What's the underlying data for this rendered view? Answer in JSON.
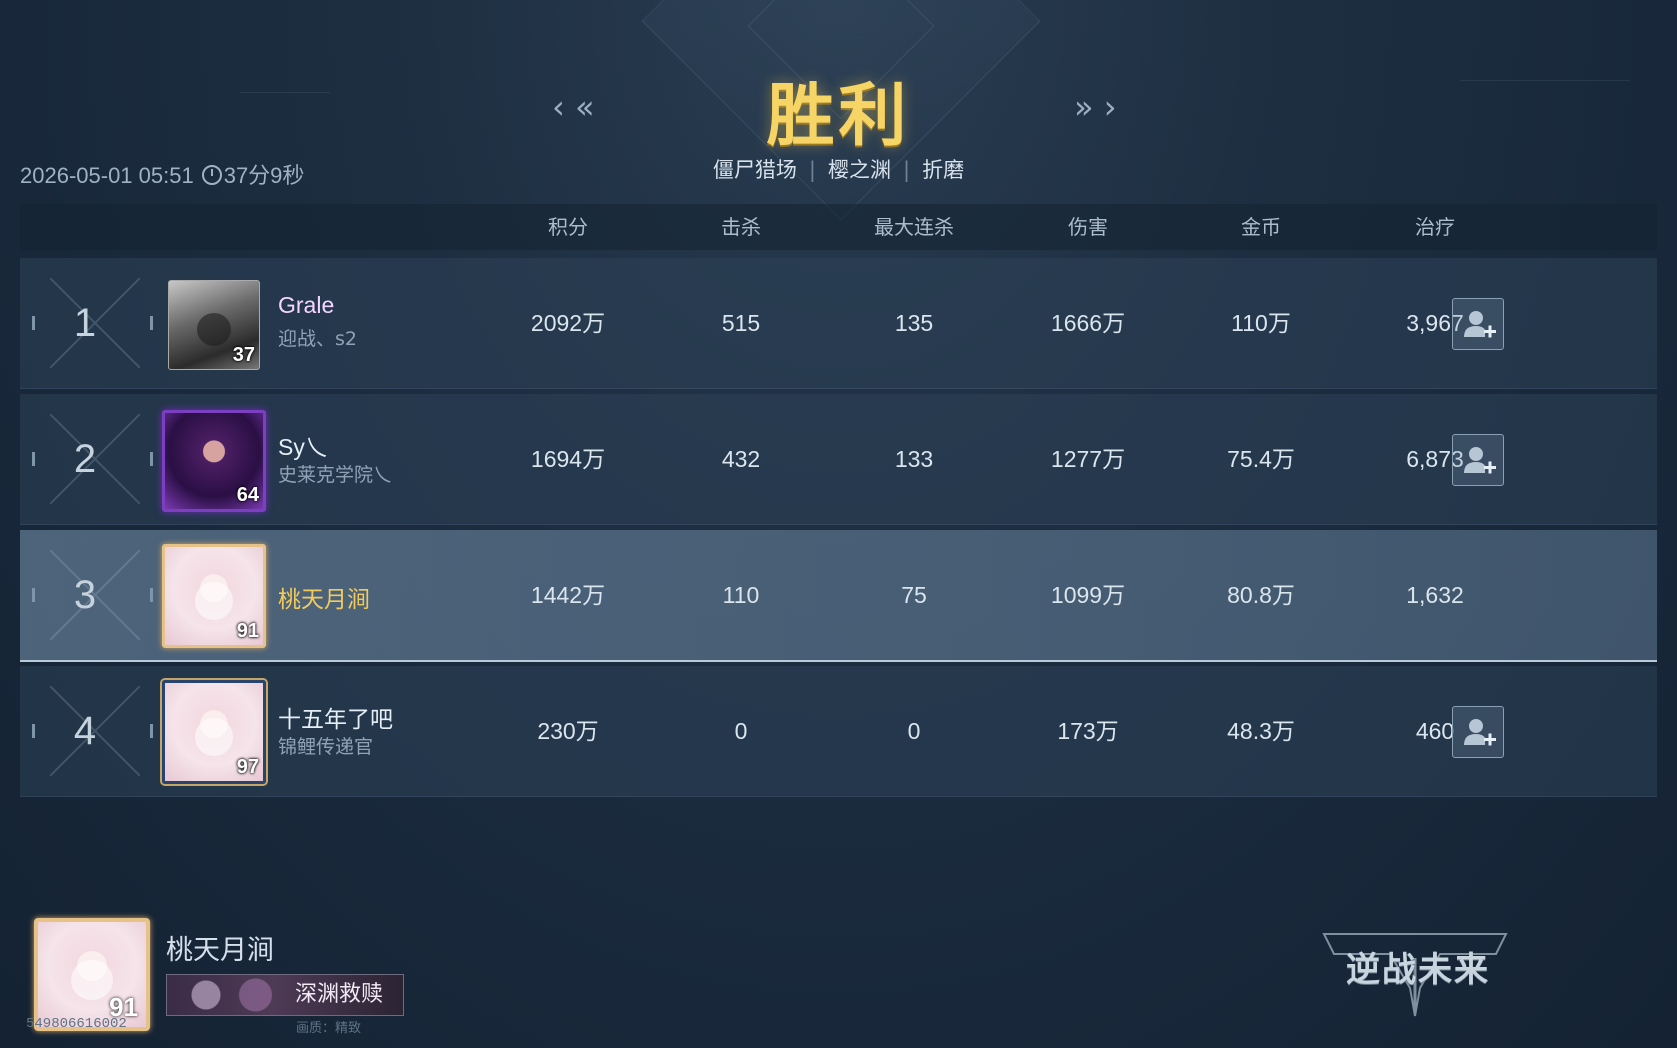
{
  "header": {
    "result_title": "胜利",
    "modes": [
      "僵尸猎场",
      "樱之渊",
      "折磨"
    ],
    "datetime": "2026-05-01 05:51",
    "duration": "37分9秒",
    "nav_left": "‹ «",
    "nav_right": "» ›"
  },
  "table": {
    "columns": [
      "积分",
      "击杀",
      "最大连杀",
      "伤害",
      "金币",
      "治疗"
    ],
    "rows": [
      {
        "rank": "1",
        "name": "Grale",
        "sub": "迎战、s2",
        "level": "37",
        "score": "2092万",
        "kills": "515",
        "max_streak": "135",
        "damage": "1666万",
        "gold": "110万",
        "heal": "3,967",
        "can_add_friend": true
      },
      {
        "rank": "2",
        "name": "Sy乀",
        "sub": "史莱克学院乀",
        "level": "64",
        "score": "1694万",
        "kills": "432",
        "max_streak": "133",
        "damage": "1277万",
        "gold": "75.4万",
        "heal": "6,873",
        "can_add_friend": true
      },
      {
        "rank": "3",
        "name": "桃天月涧",
        "sub": "",
        "level": "91",
        "score": "1442万",
        "kills": "110",
        "max_streak": "75",
        "damage": "1099万",
        "gold": "80.8万",
        "heal": "1,632",
        "can_add_friend": false,
        "is_self": true
      },
      {
        "rank": "4",
        "name": "十五年了吧",
        "sub": "锦鲤传递官",
        "level": "97",
        "score": "230万",
        "kills": "0",
        "max_streak": "0",
        "damage": "173万",
        "gold": "48.3万",
        "heal": "460",
        "can_add_friend": true
      }
    ]
  },
  "footer": {
    "self_name": "桃天月涧",
    "self_level": "91",
    "title_badge": "深渊救赎",
    "uid": "549806616002",
    "quality": "画质：精致",
    "logo_text": "逆战未来"
  },
  "colors": {
    "title_gold": "#f7d466",
    "self_name_gold": "#f3cb5a",
    "row_bg": "#2d4158",
    "self_row_bg": "#5f7891"
  },
  "icons": {
    "add_friend": "add-friend-icon",
    "clock": "clock-icon"
  }
}
